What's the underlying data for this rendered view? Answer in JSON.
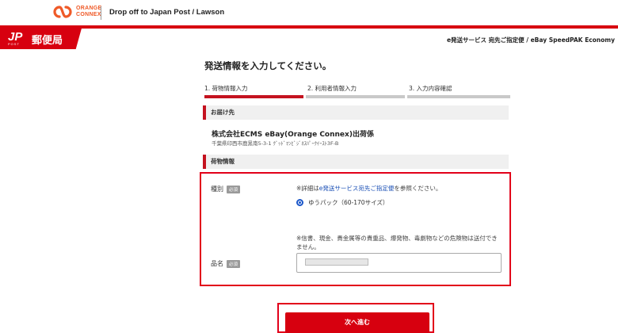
{
  "header": {
    "brand_line1": "ORANGE",
    "brand_line2": "CONNEX",
    "title": "Drop off to Japan Post / Lawson",
    "jp_name": "郵便局",
    "jp_post_label": "POST",
    "service_label": "e発送サービス 宛先ご指定便 / eBay SpeedPAK Economy"
  },
  "main": {
    "page_title": "発送情報を入力してください。",
    "steps": [
      {
        "label": "1. 荷物情報入力",
        "active": true
      },
      {
        "label": "2. 利用者情報入力",
        "active": false
      },
      {
        "label": "3. 入力内容確認",
        "active": false
      }
    ],
    "recipient_section": {
      "heading": "お届け先",
      "name": "株式会社ECMS eBay(Orange Connex)出荷係",
      "address": "千葉県印西市鹿黒南5-3-1 ｸﾞｯﾄﾞﾏﾝﾋﾞｼﾞﾈｽﾊﾟｰｸｲｰｽﾄ3F-B"
    },
    "package_section": {
      "heading": "荷物情報",
      "type_label": "種別",
      "required_badge": "必須",
      "type_note_prefix": "※詳細は",
      "type_note_link": "e発送サービス宛先ご指定便",
      "type_note_suffix": "を参照ください。",
      "type_option": "ゆうパック（60-170サイズ）",
      "warning_line1": "※信書、現金、貴金属等の貴重品、爆発物、毒劇物などの危険物は送付でき",
      "warning_line2": "ません。",
      "item_label": "品名",
      "item_required_badge": "必須"
    },
    "next_button": "次へ進む"
  }
}
